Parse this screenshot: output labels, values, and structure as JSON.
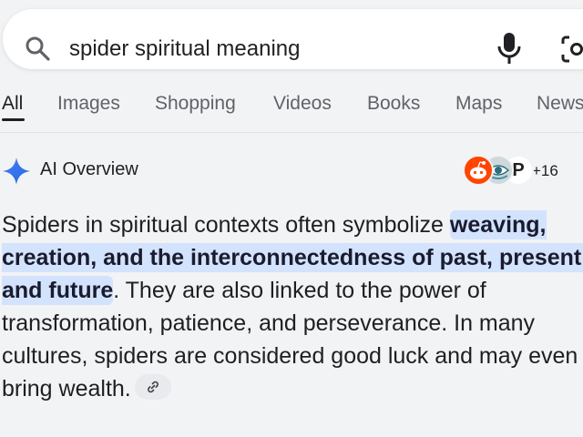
{
  "search": {
    "query": "spider spiritual meaning"
  },
  "tabs": [
    {
      "label": "All",
      "active": true
    },
    {
      "label": "Images"
    },
    {
      "label": "Shopping"
    },
    {
      "label": "Videos"
    },
    {
      "label": "Books"
    },
    {
      "label": "Maps"
    },
    {
      "label": "News"
    }
  ],
  "ai_overview": {
    "title": "AI Overview",
    "sources_more": "+16",
    "source_icons": [
      "reddit-icon",
      "eye-icon",
      "p-icon"
    ],
    "source_p_letter": "P",
    "text_before": "Spiders in spiritual contexts often symbolize ",
    "text_highlight": "weaving, creation, and the interconnectedness of past, present, and future",
    "text_after": ". They are also linked to the power of transformation, patience, and perseverance. In many cultures, spiders are considered good luck and may even bring wealth."
  },
  "colors": {
    "background": "#f2f3f5",
    "highlight": "#d3e3fd",
    "sparkle_blue": "#4285f4"
  }
}
